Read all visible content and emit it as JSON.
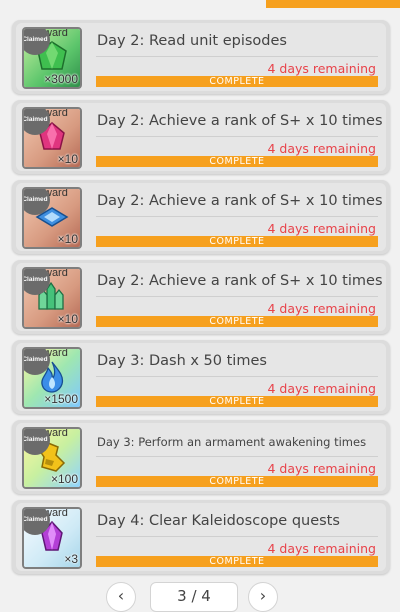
{
  "colors": {
    "accent": "#f6a01e",
    "remaining": "#e8434a",
    "bar_text": "#ffffff"
  },
  "missions": [
    {
      "title": "Day 2: Read  unit episodes",
      "quantity": "×3000",
      "remaining": "4 days remaining",
      "status": "COMPLETE",
      "claimed": "Claimed",
      "reward_tag": "ward",
      "icon": "green-gem-icon",
      "progress": 1
    },
    {
      "title": "Day 2: Achieve a rank of S+  x 10 times",
      "quantity": "×10",
      "remaining": "4 days remaining",
      "status": "COMPLETE",
      "claimed": "Claimed",
      "reward_tag": "ward",
      "icon": "pink-gem-icon",
      "progress": 1
    },
    {
      "title": "Day 2: Achieve a rank of S+  x 10 times",
      "quantity": "×10",
      "remaining": "4 days remaining",
      "status": "COMPLETE",
      "claimed": "Claimed",
      "reward_tag": "ward",
      "icon": "blue-crystal-icon",
      "progress": 1
    },
    {
      "title": "Day 2: Achieve a rank of S+  x 10 times",
      "quantity": "×10",
      "remaining": "4 days remaining",
      "status": "COMPLETE",
      "claimed": "Claimed",
      "reward_tag": "ward",
      "icon": "green-crystal-icon",
      "progress": 1
    },
    {
      "title": "Day 3: Dash  x 50 times",
      "quantity": "×1500",
      "remaining": "4 days remaining",
      "status": "COMPLETE",
      "claimed": "Claimed",
      "reward_tag": "ward",
      "icon": "blue-flame-icon",
      "progress": 1
    },
    {
      "title": "Day 3: Perform an armament awakening  times",
      "quantity": "×100",
      "remaining": "4 days remaining",
      "status": "COMPLETE",
      "claimed": "Claimed",
      "reward_tag": "ward",
      "icon": "gold-item-icon",
      "progress": 1
    },
    {
      "title": "Day 4: Clear  Kaleidoscope quests",
      "quantity": "×3",
      "remaining": "4 days remaining",
      "status": "COMPLETE",
      "claimed": "Claimed",
      "reward_tag": "ward",
      "icon": "purple-gem-icon",
      "progress": 1
    }
  ],
  "pagination": {
    "current": "3 / 4",
    "prev": "‹",
    "next": "›"
  }
}
